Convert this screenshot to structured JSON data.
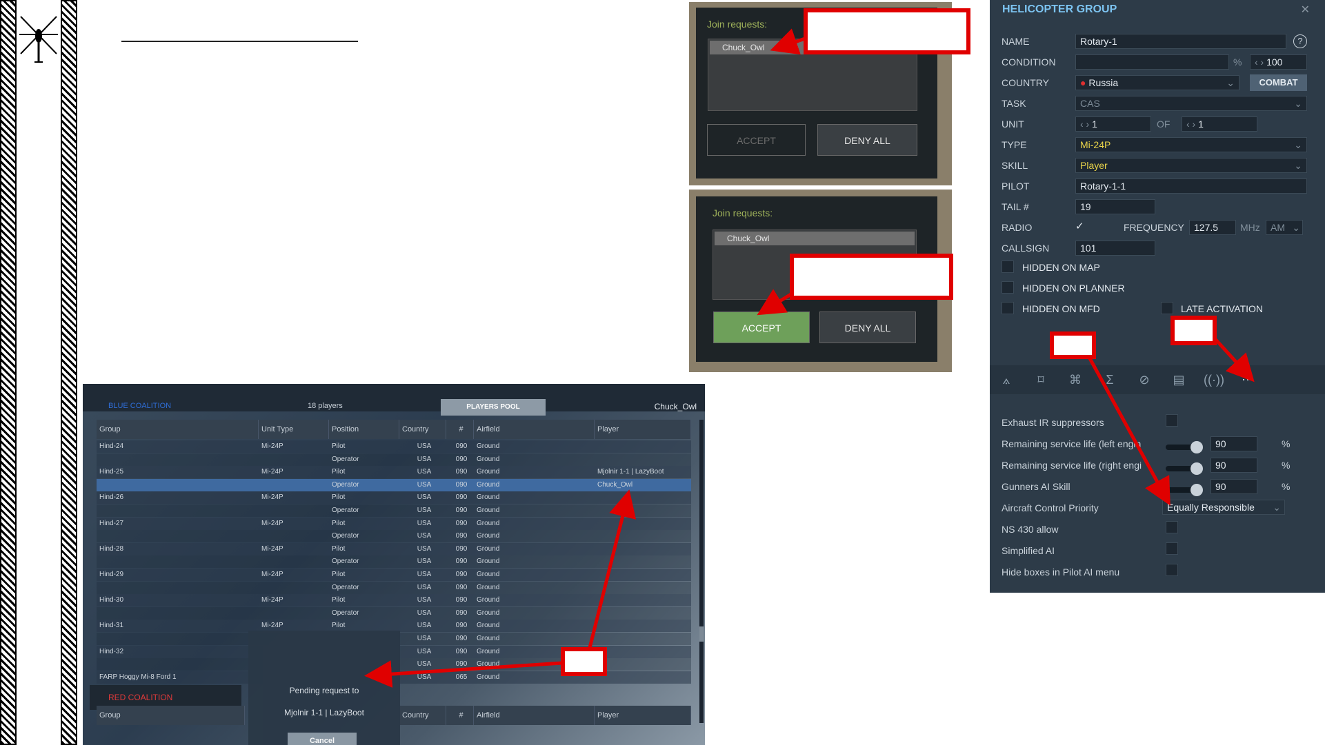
{
  "annotations_color": "#e00000",
  "join_requests_top": {
    "label": "Join requests:",
    "item": "Chuck_Owl",
    "accept_label": "ACCEPT",
    "deny_label": "DENY ALL"
  },
  "join_requests_bottom": {
    "label": "Join requests:",
    "item": "Chuck_Owl",
    "accept_label": "ACCEPT",
    "deny_label": "DENY ALL",
    "accept_color": "#6ea05a"
  },
  "editor": {
    "title": "HELICOPTER GROUP",
    "help_icon": "?",
    "name_label": "NAME",
    "name_value": "Rotary-1",
    "condition_label": "CONDITION",
    "condition_unit": "%",
    "condition_value": "100",
    "country_label": "COUNTRY",
    "country_value": "Russia",
    "combat_label": "COMBAT",
    "task_label": "TASK",
    "task_value": "CAS",
    "unit_label": "UNIT",
    "unit_value": "1",
    "of_label": "OF",
    "of_value": "1",
    "type_label": "TYPE",
    "type_value": "Mi-24P",
    "skill_label": "SKILL",
    "skill_value": "Player",
    "pilot_label": "PILOT",
    "pilot_value": "Rotary-1-1",
    "tail_label": "TAIL #",
    "tail_value": "19",
    "radio_label": "RADIO",
    "frequency_label": "FREQUENCY",
    "frequency_value": "127.5",
    "mhz_label": "MHz",
    "am_label": "AM",
    "callsign_label": "CALLSIGN",
    "callsign_value": "101",
    "hidden_map": "HIDDEN ON MAP",
    "hidden_planner": "HIDDEN ON PLANNER",
    "hidden_mfd": "HIDDEN ON MFD",
    "late_activation": "LATE ACTIVATION",
    "options": [
      {
        "label": "Exhaust IR suppressors"
      },
      {
        "label": "Remaining service life (left engin",
        "value": "90",
        "unit": "%"
      },
      {
        "label": "Remaining service life (right engi",
        "value": "90",
        "unit": "%"
      },
      {
        "label": "Gunners AI Skill",
        "value": "90",
        "unit": "%"
      },
      {
        "label": "Aircraft Control Priority",
        "value": "Equally Responsible"
      },
      {
        "label": "NS 430 allow"
      },
      {
        "label": "Simplified AI"
      },
      {
        "label": "Hide boxes in Pilot AI menu"
      }
    ]
  },
  "mp": {
    "blue_coalition": "BLUE COALITION",
    "players_count": "18 players",
    "players_pool": "PLAYERS POOL",
    "current_player": "Chuck_Owl",
    "red_coalition": "RED COALITION",
    "headers": [
      "Group",
      "Unit Type",
      "Position",
      "Country",
      "#",
      "Airfield",
      "Player"
    ],
    "rows": [
      [
        "Hind-24",
        "Mi-24P",
        "Pilot",
        "USA",
        "090",
        "Ground",
        ""
      ],
      [
        "",
        "",
        "Operator",
        "USA",
        "090",
        "Ground",
        ""
      ],
      [
        "Hind-25",
        "Mi-24P",
        "Pilot",
        "USA",
        "090",
        "Ground",
        "Mjolnir 1-1 | LazyBoot"
      ],
      [
        "",
        "",
        "Operator",
        "USA",
        "090",
        "Ground",
        "Chuck_Owl"
      ],
      [
        "Hind-26",
        "Mi-24P",
        "Pilot",
        "USA",
        "090",
        "Ground",
        ""
      ],
      [
        "",
        "",
        "Operator",
        "USA",
        "090",
        "Ground",
        ""
      ],
      [
        "Hind-27",
        "Mi-24P",
        "Pilot",
        "USA",
        "090",
        "Ground",
        ""
      ],
      [
        "",
        "",
        "Operator",
        "USA",
        "090",
        "Ground",
        ""
      ],
      [
        "Hind-28",
        "Mi-24P",
        "Pilot",
        "USA",
        "090",
        "Ground",
        ""
      ],
      [
        "",
        "",
        "Operator",
        "USA",
        "090",
        "Ground",
        ""
      ],
      [
        "Hind-29",
        "Mi-24P",
        "Pilot",
        "USA",
        "090",
        "Ground",
        ""
      ],
      [
        "",
        "",
        "Operator",
        "USA",
        "090",
        "Ground",
        ""
      ],
      [
        "Hind-30",
        "Mi-24P",
        "Pilot",
        "USA",
        "090",
        "Ground",
        ""
      ],
      [
        "",
        "",
        "Operator",
        "USA",
        "090",
        "Ground",
        ""
      ],
      [
        "Hind-31",
        "Mi-24P",
        "Pilot",
        "USA",
        "090",
        "Ground",
        ""
      ],
      [
        "",
        "",
        "",
        "USA",
        "090",
        "Ground",
        ""
      ],
      [
        "Hind-32",
        "",
        "",
        "USA",
        "090",
        "Ground",
        ""
      ],
      [
        "",
        "",
        "",
        "USA",
        "090",
        "Ground",
        ""
      ],
      [
        "FARP Hoggy Mi-8 Ford 1",
        "",
        "",
        "USA",
        "065",
        "Ground",
        ""
      ]
    ],
    "pending_text": "Pending request to",
    "pending_target": "Mjolnir 1-1 | LazyBoot",
    "cancel_label": "Cancel",
    "footer_headers": [
      "Group",
      "Country",
      "#",
      "Airfield",
      "Player"
    ]
  }
}
